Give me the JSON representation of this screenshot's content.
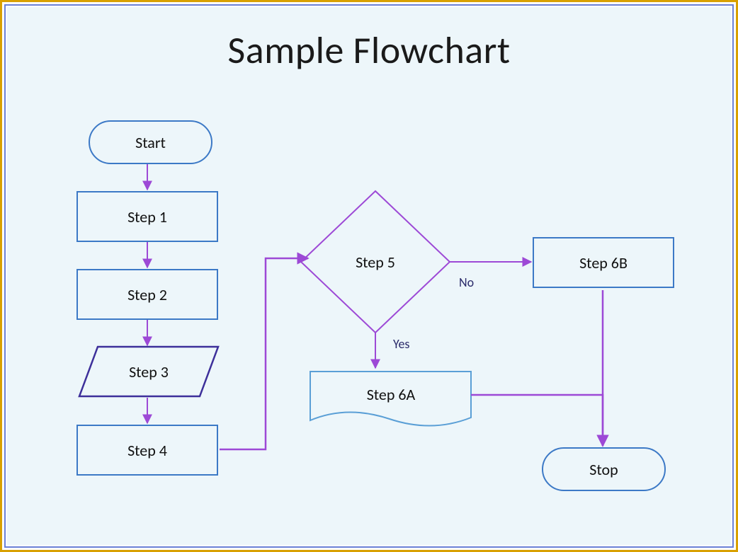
{
  "title": "Sample Flowchart",
  "nodes": {
    "start": {
      "label": "Start",
      "type": "terminator"
    },
    "step1": {
      "label": "Step 1",
      "type": "process"
    },
    "step2": {
      "label": "Step 2",
      "type": "process"
    },
    "step3": {
      "label": "Step 3",
      "type": "parallelogram"
    },
    "step4": {
      "label": "Step 4",
      "type": "process"
    },
    "step5": {
      "label": "Step 5",
      "type": "decision"
    },
    "step6a": {
      "label": "Step 6A",
      "type": "document"
    },
    "step6b": {
      "label": "Step 6B",
      "type": "process"
    },
    "stop": {
      "label": "Stop",
      "type": "terminator"
    }
  },
  "edges": {
    "yes": "Yes",
    "no": "No"
  },
  "colors": {
    "blue": "#3c79c6",
    "purple": "#8a3fc0",
    "purpleLine": "#9d49d6",
    "blueLine": "#5a9fd6"
  }
}
